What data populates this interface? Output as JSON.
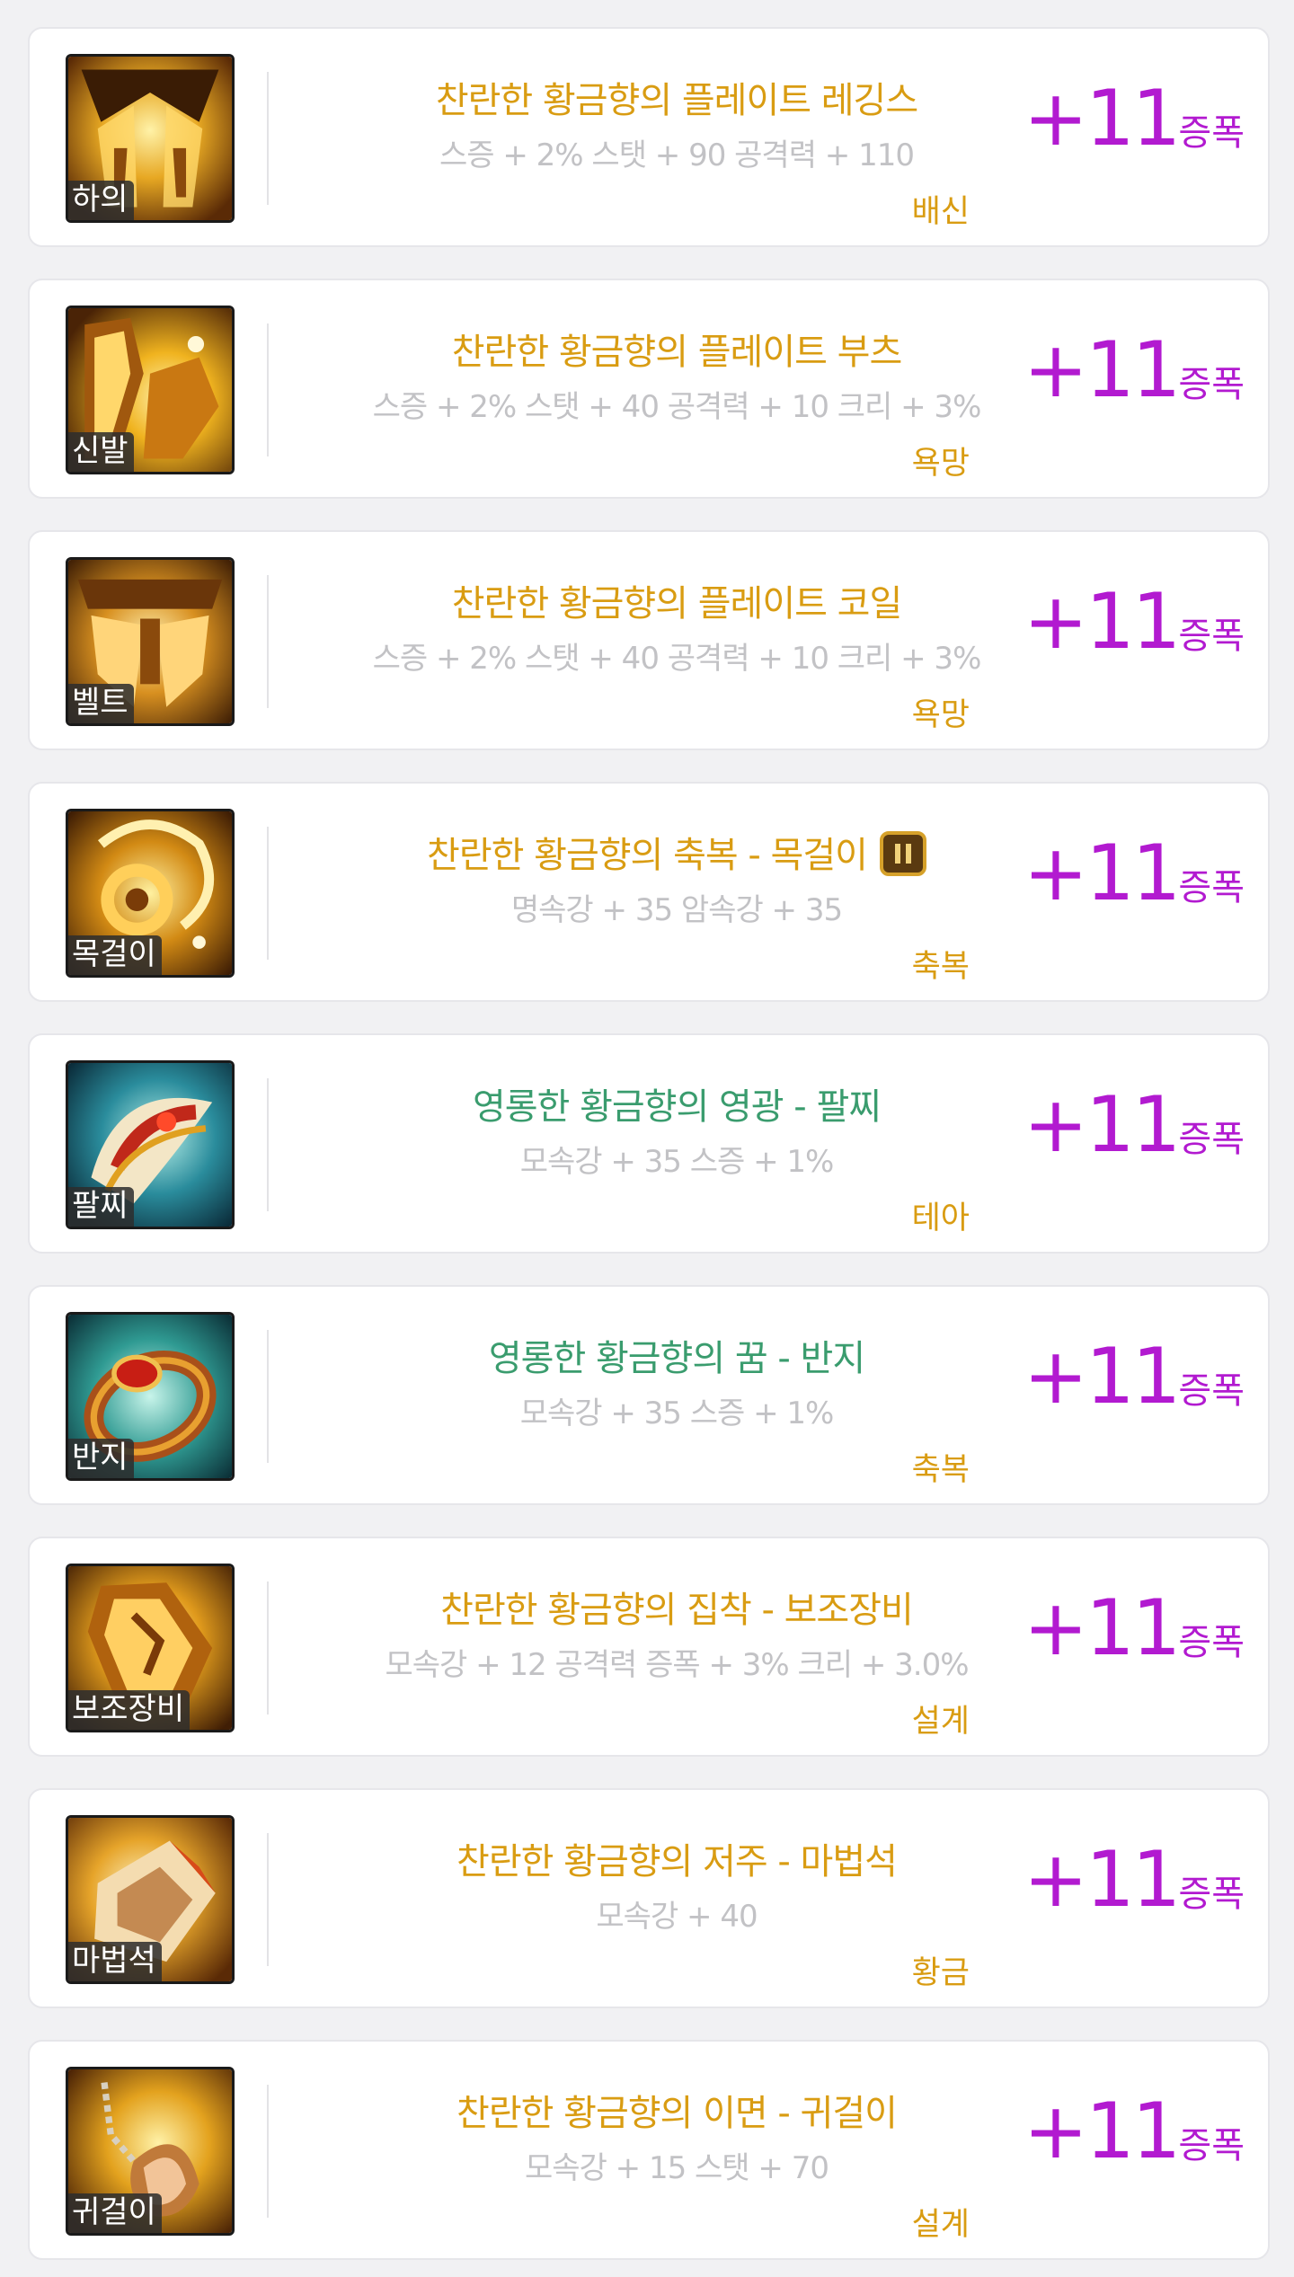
{
  "colors": {
    "gold_name": "#d99c12",
    "green_name": "#3a9c6e",
    "stat_gray": "#c2c2c5",
    "tag_gold": "#d99c12",
    "level_purple": "#b21ad0",
    "card_border": "#e6e6ea"
  },
  "items": [
    {
      "slot": "하의",
      "name": "찬란한 황금향의 플레이트 레깅스",
      "rarity": "gold",
      "stats": "스증 + 2% 스탯 + 90 공격력 + 110",
      "tag": "배신",
      "level": "+11",
      "level_unit": "증폭",
      "icon": "plate-leggings-icon"
    },
    {
      "slot": "신발",
      "name": "찬란한 황금향의 플레이트 부츠",
      "rarity": "gold",
      "stats": "스증 + 2% 스탯 + 40 공격력 + 10 크리 + 3%",
      "tag": "욕망",
      "level": "+11",
      "level_unit": "증폭",
      "icon": "plate-boots-icon"
    },
    {
      "slot": "벨트",
      "name": "찬란한 황금향의 플레이트 코일",
      "rarity": "gold",
      "stats": "스증 + 2% 스탯 + 40 공격력 + 10 크리 + 3%",
      "tag": "욕망",
      "level": "+11",
      "level_unit": "증폭",
      "icon": "plate-coil-belt-icon"
    },
    {
      "slot": "목걸이",
      "name": "찬란한 황금향의 축복 - 목걸이",
      "rarity": "gold",
      "stats": "명속강 + 35 암속강 + 35",
      "tag": "축복",
      "level": "+11",
      "level_unit": "증폭",
      "icon": "necklace-icon",
      "badge": "pause-badge-icon"
    },
    {
      "slot": "팔찌",
      "name": "영롱한 황금향의 영광 - 팔찌",
      "rarity": "green",
      "stats": "모속강 + 35 스증 + 1%",
      "tag": "테아",
      "level": "+11",
      "level_unit": "증폭",
      "icon": "bracelet-icon"
    },
    {
      "slot": "반지",
      "name": "영롱한 황금향의 꿈 - 반지",
      "rarity": "green",
      "stats": "모속강 + 35 스증 + 1%",
      "tag": "축복",
      "level": "+11",
      "level_unit": "증폭",
      "icon": "ring-icon"
    },
    {
      "slot": "보조장비",
      "name": "찬란한 황금향의 집착 - 보조장비",
      "rarity": "gold",
      "stats": "모속강 + 12 공격력 증폭 + 3% 크리 + 3.0%",
      "tag": "설계",
      "level": "+11",
      "level_unit": "증폭",
      "icon": "sub-equipment-icon"
    },
    {
      "slot": "마법석",
      "name": "찬란한 황금향의 저주 - 마법석",
      "rarity": "gold",
      "stats": "모속강 + 40",
      "tag": "황금",
      "level": "+11",
      "level_unit": "증폭",
      "icon": "magic-stone-icon"
    },
    {
      "slot": "귀걸이",
      "name": "찬란한 황금향의 이면 - 귀걸이",
      "rarity": "gold",
      "stats": "모속강 + 15 스탯 + 70",
      "tag": "설계",
      "level": "+11",
      "level_unit": "증폭",
      "icon": "earring-icon"
    }
  ]
}
